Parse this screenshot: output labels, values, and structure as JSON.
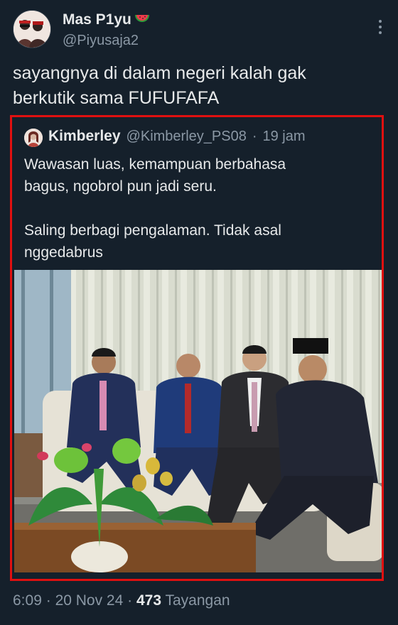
{
  "tweet": {
    "display_name": "Mas P1yu",
    "name_emoji_icon": "watermelon-icon",
    "handle": "@Piyusaja2",
    "menu_icon": "more-vertical-icon",
    "text_lines": [
      "sayangnya di dalam negeri kalah gak",
      "berkutik sama FUFUFAFA"
    ]
  },
  "quote": {
    "display_name": "Kimberley",
    "handle": "@Kimberley_PS08",
    "separator": "·",
    "time": "19 jam",
    "paragraphs": [
      [
        "Wawasan luas, kemampuan berbahasa",
        "bagus, ngobrol pun jadi seru."
      ],
      [
        "Saling berbagi pengalaman. Tidak asal",
        "nggedabrus"
      ]
    ],
    "image_icon": "photo-four-men-seated-icon"
  },
  "footer": {
    "time": "6:09",
    "sep1": "·",
    "date": "20 Nov 24",
    "sep2": "·",
    "views_count": "473",
    "views_label": "Tayangan"
  },
  "colors": {
    "background": "#15202b",
    "text_primary": "#e7e9ea",
    "text_secondary": "#8b98a5",
    "highlight_border": "#e01010"
  }
}
